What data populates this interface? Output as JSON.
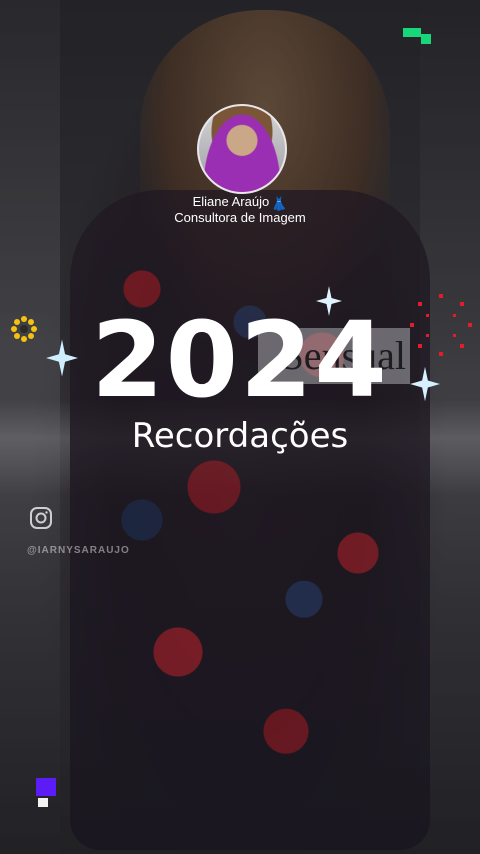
{
  "profile": {
    "name": "Eliane Araújo",
    "name_emoji": "👗",
    "role": "Consultora de Imagem"
  },
  "title": {
    "year": "2024",
    "subtitle": "Recordações"
  },
  "background": {
    "brand_text": "Sensual",
    "watermark_handle": "@IARNYSARAUJO"
  },
  "colors": {
    "accent_green": "#18d67a",
    "accent_purple": "#5b1cf5",
    "sparkle_red": "#e11d2a",
    "sparkle_yellow": "#f5c211"
  },
  "icons": [
    "app-logo-icon",
    "instagram-icon",
    "sparkle-icon",
    "flower-icon",
    "firework-icon"
  ]
}
